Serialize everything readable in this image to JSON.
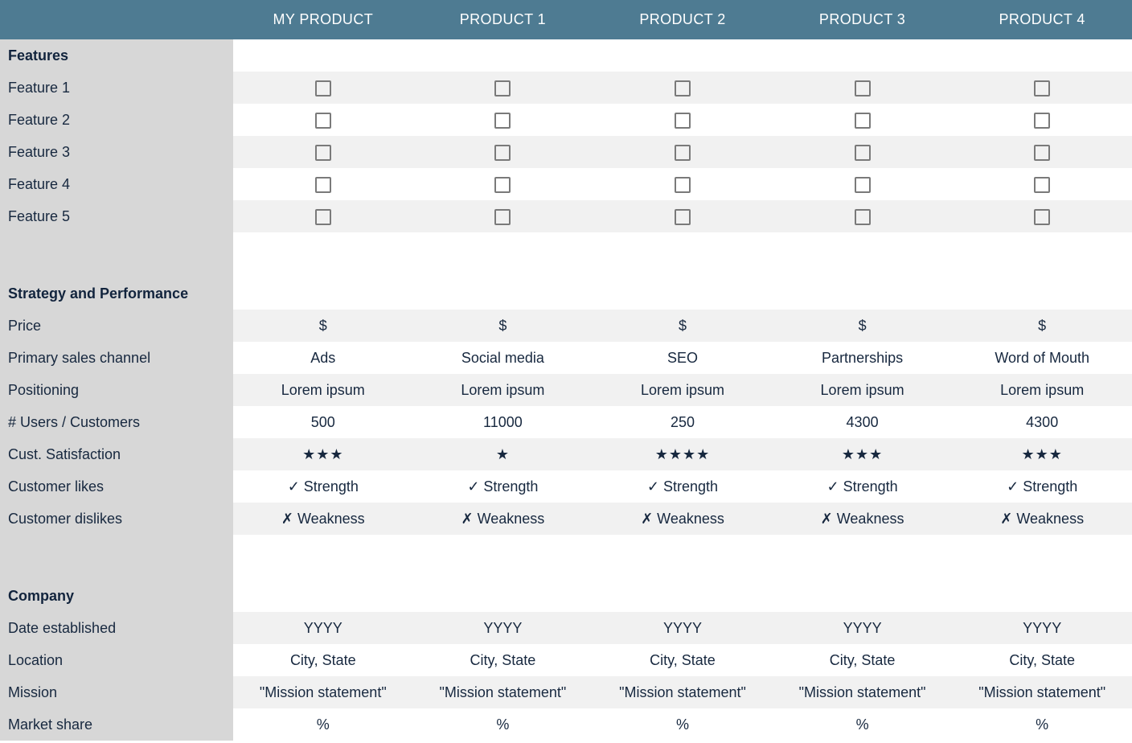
{
  "columns": [
    "MY PRODUCT",
    "PRODUCT 1",
    "PRODUCT 2",
    "PRODUCT 3",
    "PRODUCT 4"
  ],
  "features": {
    "section_label": "Features",
    "rows": [
      {
        "label": "Feature 1",
        "cells": [
          "checkbox",
          "checkbox",
          "checkbox",
          "checkbox",
          "checkbox"
        ]
      },
      {
        "label": "Feature 2",
        "cells": [
          "checkbox",
          "checkbox",
          "checkbox",
          "checkbox",
          "checkbox"
        ]
      },
      {
        "label": "Feature 3",
        "cells": [
          "checkbox",
          "checkbox",
          "checkbox",
          "checkbox",
          "checkbox"
        ]
      },
      {
        "label": "Feature 4",
        "cells": [
          "checkbox",
          "checkbox",
          "checkbox",
          "checkbox",
          "checkbox"
        ]
      },
      {
        "label": "Feature 5",
        "cells": [
          "checkbox",
          "checkbox",
          "checkbox",
          "checkbox",
          "checkbox"
        ]
      }
    ]
  },
  "strategy": {
    "section_label": "Strategy and Performance",
    "rows": [
      {
        "label": "Price",
        "cells": [
          "$",
          "$",
          "$",
          "$",
          "$"
        ]
      },
      {
        "label": "Primary sales channel",
        "cells": [
          "Ads",
          "Social media",
          "SEO",
          "Partnerships",
          "Word of Mouth"
        ]
      },
      {
        "label": "Positioning",
        "cells": [
          "Lorem ipsum",
          "Lorem ipsum",
          "Lorem ipsum",
          "Lorem ipsum",
          "Lorem ipsum"
        ]
      },
      {
        "label": "# Users / Customers",
        "cells": [
          "500",
          "11000",
          "250",
          "4300",
          "4300"
        ]
      },
      {
        "label": "Cust. Satisfaction",
        "stars": [
          3,
          1,
          4,
          3,
          3
        ]
      },
      {
        "label": "Customer likes",
        "cells": [
          "✓ Strength",
          "✓ Strength",
          "✓ Strength",
          "✓ Strength",
          "✓ Strength"
        ]
      },
      {
        "label": "Customer dislikes",
        "cells": [
          "✗ Weakness",
          "✗ Weakness",
          "✗ Weakness",
          "✗ Weakness",
          "✗ Weakness"
        ]
      }
    ]
  },
  "company": {
    "section_label": "Company",
    "rows": [
      {
        "label": "Date established",
        "cells": [
          "YYYY",
          "YYYY",
          "YYYY",
          "YYYY",
          "YYYY"
        ]
      },
      {
        "label": "Location",
        "cells": [
          "City, State",
          "City, State",
          "City, State",
          "City, State",
          "City, State"
        ]
      },
      {
        "label": "Mission",
        "cells": [
          "\"Mission statement\"",
          "\"Mission statement\"",
          "\"Mission statement\"",
          "\"Mission statement\"",
          "\"Mission statement\""
        ]
      },
      {
        "label": "Market share",
        "cells": [
          "%",
          "%",
          "%",
          "%",
          "%"
        ]
      }
    ]
  },
  "chart_data": {
    "type": "table",
    "columns": [
      "MY PRODUCT",
      "PRODUCT 1",
      "PRODUCT 2",
      "PRODUCT 3",
      "PRODUCT 4"
    ],
    "sections": [
      {
        "name": "Features",
        "rows": [
          {
            "label": "Feature 1",
            "values": [
              false,
              false,
              false,
              false,
              false
            ]
          },
          {
            "label": "Feature 2",
            "values": [
              false,
              false,
              false,
              false,
              false
            ]
          },
          {
            "label": "Feature 3",
            "values": [
              false,
              false,
              false,
              false,
              false
            ]
          },
          {
            "label": "Feature 4",
            "values": [
              false,
              false,
              false,
              false,
              false
            ]
          },
          {
            "label": "Feature 5",
            "values": [
              false,
              false,
              false,
              false,
              false
            ]
          }
        ]
      },
      {
        "name": "Strategy and Performance",
        "rows": [
          {
            "label": "Price",
            "values": [
              "$",
              "$",
              "$",
              "$",
              "$"
            ]
          },
          {
            "label": "Primary sales channel",
            "values": [
              "Ads",
              "Social media",
              "SEO",
              "Partnerships",
              "Word of Mouth"
            ]
          },
          {
            "label": "Positioning",
            "values": [
              "Lorem ipsum",
              "Lorem ipsum",
              "Lorem ipsum",
              "Lorem ipsum",
              "Lorem ipsum"
            ]
          },
          {
            "label": "# Users / Customers",
            "values": [
              500,
              11000,
              250,
              4300,
              4300
            ]
          },
          {
            "label": "Cust. Satisfaction",
            "values": [
              3,
              1,
              4,
              3,
              3
            ],
            "unit": "stars"
          },
          {
            "label": "Customer likes",
            "values": [
              "✓ Strength",
              "✓ Strength",
              "✓ Strength",
              "✓ Strength",
              "✓ Strength"
            ]
          },
          {
            "label": "Customer dislikes",
            "values": [
              "✗ Weakness",
              "✗ Weakness",
              "✗ Weakness",
              "✗ Weakness",
              "✗ Weakness"
            ]
          }
        ]
      },
      {
        "name": "Company",
        "rows": [
          {
            "label": "Date established",
            "values": [
              "YYYY",
              "YYYY",
              "YYYY",
              "YYYY",
              "YYYY"
            ]
          },
          {
            "label": "Location",
            "values": [
              "City, State",
              "City, State",
              "City, State",
              "City, State",
              "City, State"
            ]
          },
          {
            "label": "Mission",
            "values": [
              "\"Mission statement\"",
              "\"Mission statement\"",
              "\"Mission statement\"",
              "\"Mission statement\"",
              "\"Mission statement\""
            ]
          },
          {
            "label": "Market share",
            "values": [
              "%",
              "%",
              "%",
              "%",
              "%"
            ]
          }
        ]
      }
    ]
  }
}
